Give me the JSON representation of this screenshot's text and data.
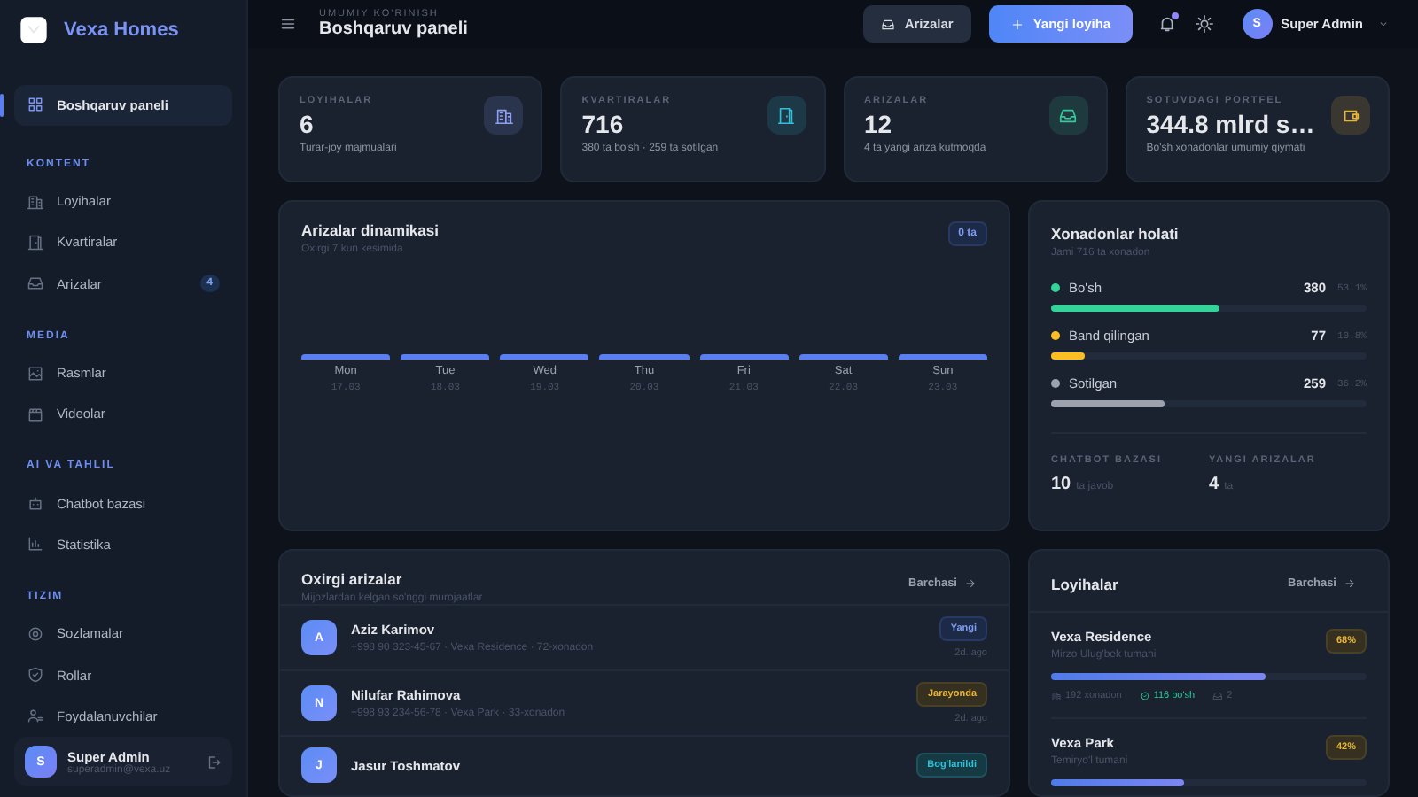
{
  "sidebar": {
    "brand": "Vexa Homes",
    "sections": [
      {
        "items": [
          {
            "label": "Boshqaruv paneli",
            "selected": true
          }
        ]
      },
      {
        "title": "KONTENT",
        "items": [
          {
            "label": "Loyihalar",
            "selected": false
          },
          {
            "label": "Kvartiralar",
            "selected": false
          },
          {
            "label": "Arizalar",
            "selected": false,
            "badge": "4"
          }
        ]
      },
      {
        "title": "MEDIA",
        "items": [
          {
            "label": "Rasmlar",
            "selected": false
          },
          {
            "label": "Videolar",
            "selected": false
          }
        ]
      },
      {
        "title": "AI VA TAHLIL",
        "items": [
          {
            "label": "Chatbot bazasi",
            "selected": false
          },
          {
            "label": "Statistika",
            "selected": false
          }
        ]
      },
      {
        "title": "TIZIM",
        "items": [
          {
            "label": "Sozlamalar",
            "selected": false
          },
          {
            "label": "Rollar",
            "selected": false
          },
          {
            "label": "Foydalanuvchilar",
            "selected": false
          }
        ]
      }
    ],
    "user": {
      "initial": "S",
      "name": "Super Admin",
      "email": "superadmin@vexa.uz"
    }
  },
  "header": {
    "eyebrow": "UMUMIY KO'RINISH",
    "title": "Boshqaruv paneli",
    "buttons": [
      {
        "label": "Arizalar",
        "kind": "secondary"
      },
      {
        "label": "Yangi loyiha",
        "kind": "primary"
      }
    ],
    "notifications_unread": true,
    "user": {
      "initial": "S",
      "name": "Super Admin"
    }
  },
  "stats": [
    {
      "label": "LOYIHALAR",
      "value": "6",
      "note": "Turar-joy majmualari",
      "color": "#8ea0f6"
    },
    {
      "label": "KVARTIRALAR",
      "value": "716",
      "note": "380 ta bo'sh · 259 ta sotilgan",
      "color": "#30c0d8"
    },
    {
      "label": "ARIZALAR",
      "value": "12",
      "note": "4 ta yangi ariza kutmoqda",
      "color": "#36c99a"
    },
    {
      "label": "SOTUVDAGI PORTFEL",
      "value": "344.8 mlrd s…",
      "note": "Bo'sh xonadonlar umumiy qiymati",
      "color": "#e9b534"
    }
  ],
  "activity": {
    "title": "Arizalar dinamikasi",
    "subtitle": "Oxirgi 7 kun kesimida",
    "total": "0 ta",
    "days": [
      {
        "day": "Mon",
        "date": "17.03"
      },
      {
        "day": "Tue",
        "date": "18.03"
      },
      {
        "day": "Wed",
        "date": "19.03"
      },
      {
        "day": "Thu",
        "date": "20.03"
      },
      {
        "day": "Fri",
        "date": "21.03"
      },
      {
        "day": "Sat",
        "date": "22.03"
      },
      {
        "day": "Sun",
        "date": "23.03"
      }
    ]
  },
  "apartments": {
    "title": "Xonadonlar holati",
    "subtitle": "Jami 716 ta xonadon",
    "statuses": [
      {
        "label": "Bo'sh",
        "count": "380",
        "percent": "53.1%",
        "level": 0.531,
        "color": "#34d399"
      },
      {
        "label": "Band qilingan",
        "count": "77",
        "percent": "10.8%",
        "level": 0.108,
        "color": "#fbbf24"
      },
      {
        "label": "Sotilgan",
        "count": "259",
        "percent": "36.2%",
        "level": 0.362,
        "color": "#9ca3af"
      }
    ],
    "footer": [
      {
        "label": "CHATBOT BAZASI",
        "value": "10",
        "unit": "ta javob"
      },
      {
        "label": "YANGI ARIZALAR",
        "value": "4",
        "unit": "ta"
      }
    ]
  },
  "requests": {
    "title": "Oxirgi arizalar",
    "subtitle": "Mijozlardan kelgan so'nggi murojaatlar",
    "link": "Barchasi",
    "rows": [
      {
        "initial": "A",
        "name": "Aziz Karimov",
        "details": "+998 90 323-45-67 · Vexa Residence · 72-xonadon",
        "status": "Yangi",
        "kind": "new",
        "time": "2d. ago"
      },
      {
        "initial": "N",
        "name": "Nilufar Rahimova",
        "details": "+998 93 234-56-78 · Vexa Park · 33-xonadon",
        "status": "Jarayonda",
        "kind": "progress",
        "time": "2d. ago"
      },
      {
        "initial": "J",
        "name": "Jasur Toshmatov",
        "status": "Bog'lanildi",
        "kind": "contacted"
      }
    ]
  },
  "projects": {
    "title": "Loyihalar",
    "link": "Barchasi",
    "items": [
      {
        "name": "Vexa Residence",
        "location": "Mirzo Ulug'bek tumani",
        "percent": "68%",
        "level": 0.68,
        "stats": {
          "apartments": "192 xonadon",
          "free": "116 bo'sh",
          "requests": "2"
        }
      },
      {
        "name": "Vexa Park",
        "location": "Temiryo'l tumani",
        "percent": "42%",
        "level": 0.42
      }
    ]
  }
}
